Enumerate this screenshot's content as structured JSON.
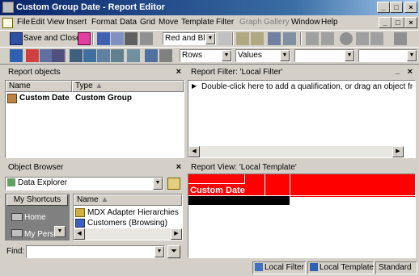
{
  "window": {
    "title": "Custom Group Date - Report Editor"
  },
  "menu": [
    "File",
    "Edit",
    "View",
    "Insert",
    "Format",
    "Data",
    "Grid",
    "Move",
    "Template",
    "Filter",
    "Graph",
    "Gallery",
    "Window",
    "Help"
  ],
  "menu_disabled": [
    "Graph",
    "Gallery"
  ],
  "toolbar": {
    "save_close": "Save and Close",
    "style_value": "Red and Black",
    "rows_value": "Rows",
    "values_value": "Values"
  },
  "report_objects": {
    "title": "Report objects",
    "col_name": "Name",
    "col_type": "Type",
    "rows": [
      {
        "name": "Custom Date",
        "type": "Custom Group"
      }
    ]
  },
  "report_filter": {
    "title": "Report Filter: 'Local Filter'",
    "hint": "Double-click here to add a qualification, or drag an object from the obj"
  },
  "object_browser": {
    "title": "Object Browser",
    "source": "Data Explorer",
    "shortcuts_label": "My Shortcuts",
    "shortcuts": [
      "Home",
      "My Perso"
    ],
    "col_name": "Name",
    "items": [
      "MDX Adapter Hierarchies",
      "Customers (Browsing)"
    ],
    "find_label": "Find:"
  },
  "report_view": {
    "title": "Report View: 'Local Template'",
    "header_cell": "Custom Date",
    "colors": {
      "header": "#ff0000",
      "band": "#000000"
    }
  },
  "status": {
    "filter": "Local Filter",
    "template": "Local Template",
    "mode": "Standard"
  }
}
